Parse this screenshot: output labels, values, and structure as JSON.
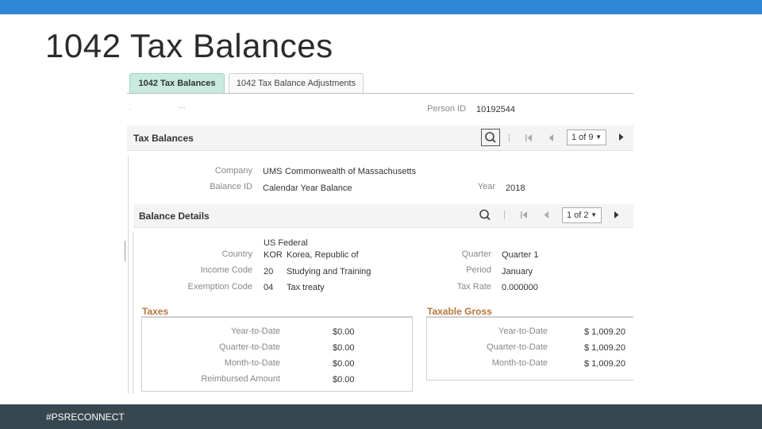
{
  "slide": {
    "title": "1042 Tax Balances",
    "footer": "#PSRECONNECT"
  },
  "tabs": [
    {
      "label": "1042 Tax Balances",
      "active": true
    },
    {
      "label": "1042 Tax Balance Adjustments",
      "active": false
    }
  ],
  "header": {
    "dots_left": ".",
    "dots_mid": "...",
    "person_id_label": "Person ID",
    "person_id_value": "10192544"
  },
  "tax_balances": {
    "title": "Tax Balances",
    "pager": "1 of 9",
    "company_label": "Company",
    "company_code": "UMS",
    "company_name": "Commonwealth of Massachusetts",
    "balance_id_label": "Balance ID",
    "balance_id_value": "Calendar Year Balance",
    "year_label": "Year",
    "year_value": "2018"
  },
  "balance_details": {
    "title": "Balance Details",
    "pager": "1 of 2",
    "country_top": "US Federal",
    "country_label": "Country",
    "country_code": "KOR",
    "country_name": "Korea, Republic of",
    "income_code_label": "Income Code",
    "income_code": "20",
    "income_desc": "Studying and Training",
    "exemption_code_label": "Exemption Code",
    "exemption_code": "04",
    "exemption_desc": "Tax treaty",
    "quarter_label": "Quarter",
    "quarter_value": "Quarter 1",
    "period_label": "Period",
    "period_value": "January",
    "tax_rate_label": "Tax Rate",
    "tax_rate_value": "0.000000"
  },
  "taxes": {
    "title": "Taxes",
    "rows": [
      {
        "label": "Year-to-Date",
        "value": "$0.00"
      },
      {
        "label": "Quarter-to-Date",
        "value": "$0.00"
      },
      {
        "label": "Month-to-Date",
        "value": "$0.00"
      },
      {
        "label": "Reimbursed Amount",
        "value": "$0.00"
      }
    ]
  },
  "taxable_gross": {
    "title": "Taxable Gross",
    "rows": [
      {
        "label": "Year-to-Date",
        "value": "$ 1,009.20"
      },
      {
        "label": "Quarter-to-Date",
        "value": "$ 1,009.20"
      },
      {
        "label": "Month-to-Date",
        "value": "$ 1,009.20"
      }
    ]
  },
  "colors": {
    "top_bar": "#2e86d6",
    "footer_bg": "#37474f",
    "active_tab": "#c8eadf",
    "section_title": "#b8763a"
  },
  "icons": [
    "search-icon",
    "first-page-icon",
    "previous-icon",
    "next-icon",
    "dropdown-caret-icon"
  ]
}
